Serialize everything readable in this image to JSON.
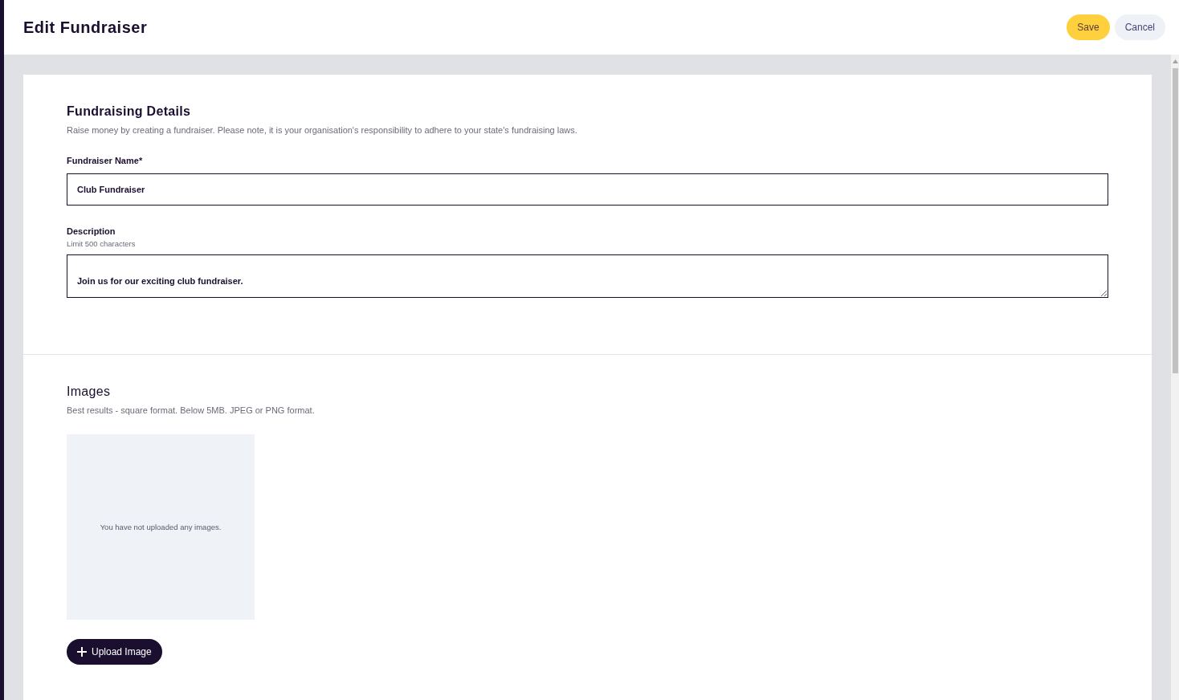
{
  "header": {
    "title": "Edit Fundraiser",
    "buttons": [
      {
        "label": "Save",
        "kind": "primary"
      },
      {
        "label": "Cancel",
        "kind": "secondary"
      }
    ]
  },
  "details": {
    "heading": "Fundraising Details",
    "intro": "Raise money by creating a fundraiser. Please note, it is your organisation's responsibility to adhere to your state's fundraising laws.",
    "name_field": {
      "label": "Fundraiser Name",
      "required_mark": "*",
      "value": "Club Fundraiser"
    },
    "description_field": {
      "label": "Description",
      "hint": "Limit 500 characters",
      "value": "Join us for our exciting club fundraiser."
    }
  },
  "images": {
    "heading": "Images",
    "intro": "Best results - square format. Below 5MB. JPEG or PNG format.",
    "empty_message": "You have not uploaded any images.",
    "upload_button": "Upload Image"
  }
}
